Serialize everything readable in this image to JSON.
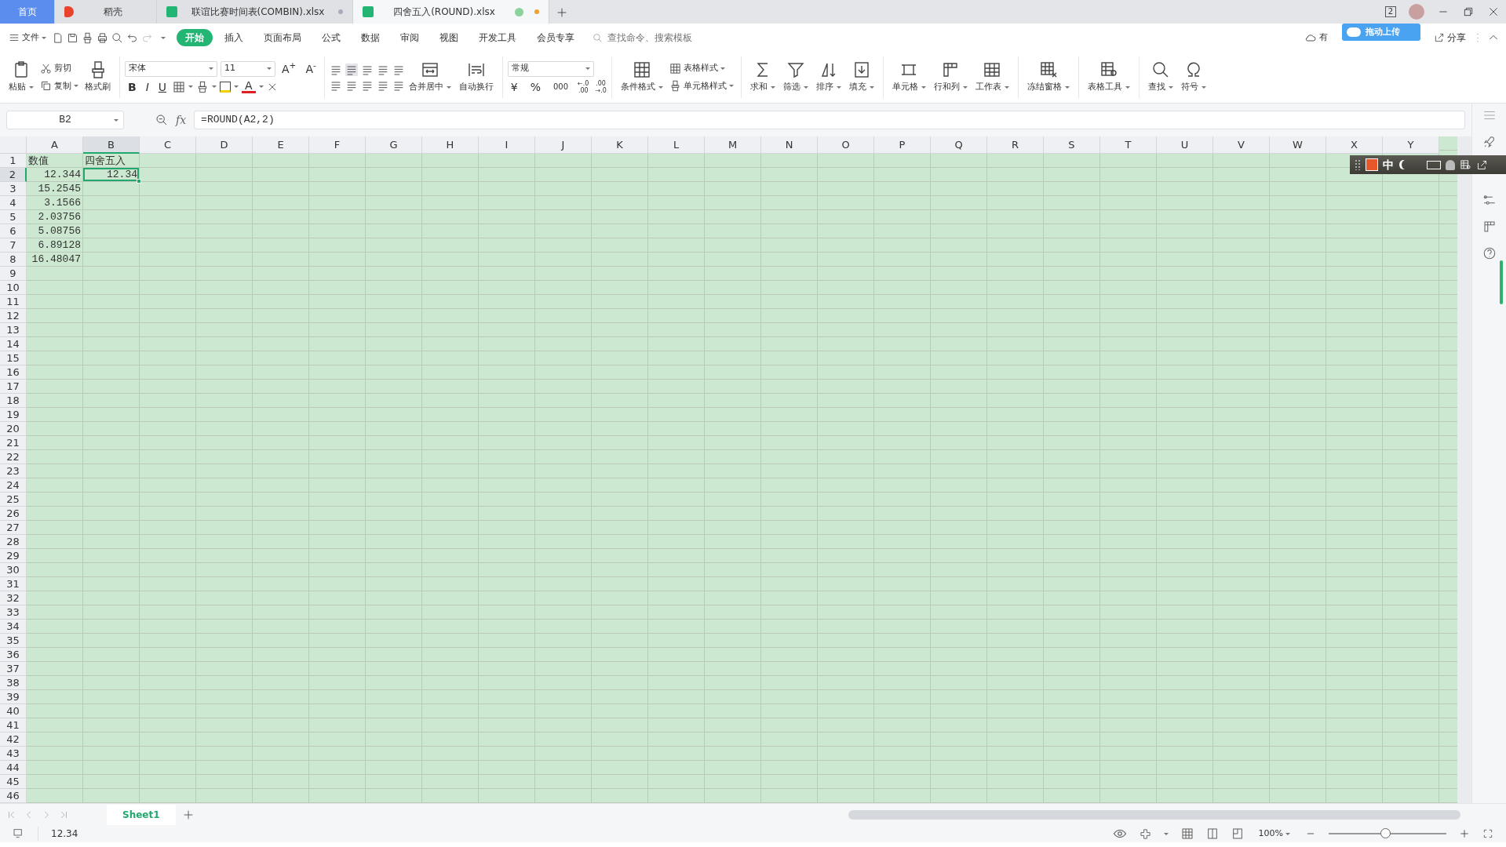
{
  "app_tabs": [
    {
      "label": "首页",
      "kind": "home",
      "selected": false
    },
    {
      "label": "稻壳",
      "kind": "docer",
      "selected": false
    },
    {
      "label": "联谊比赛时间表(COMBIN).xlsx",
      "kind": "sheet",
      "selected": false
    },
    {
      "label": "四舍五入(ROUND).xlsx",
      "kind": "sheet",
      "selected": true
    }
  ],
  "window_count": "2",
  "menu": {
    "file": "文件",
    "tabs": [
      {
        "label": "开始",
        "selected": true
      },
      {
        "label": "插入",
        "selected": false
      },
      {
        "label": "页面布局",
        "selected": false
      },
      {
        "label": "公式",
        "selected": false
      },
      {
        "label": "数据",
        "selected": false
      },
      {
        "label": "审阅",
        "selected": false
      },
      {
        "label": "视图",
        "selected": false
      },
      {
        "label": "开发工具",
        "selected": false
      },
      {
        "label": "会员专享",
        "selected": false
      }
    ],
    "search_placeholder": "查找命令、搜索模板",
    "cloud_label": "有",
    "share": "分享"
  },
  "upload_popup": "拖动上传",
  "ribbon": {
    "paste": "粘贴",
    "cut": "剪切",
    "copy": "复制",
    "painter": "格式刷",
    "font_name": "宋体",
    "font_size": "11",
    "grow": "A$^{+}$",
    "shrink": "A$^{-}$",
    "bold": "B",
    "italic": "I",
    "underline": "U",
    "font_color": "A",
    "merge": "合并居中",
    "wrap": "自动换行",
    "number_format": "常规",
    "currency": "¥",
    "percent": "%",
    "thousands": "000",
    "inc_decimal": [
      "←.0",
      ".00"
    ],
    "dec_decimal": [
      ".00",
      "→.0"
    ],
    "table_style": "表格样式",
    "cell_style": "单元格样式",
    "conditional": "条件格式",
    "tools": [
      {
        "label": "求和"
      },
      {
        "label": "筛选"
      },
      {
        "label": "排序"
      },
      {
        "label": "填充"
      },
      {
        "label": "单元格"
      },
      {
        "label": "行和列"
      },
      {
        "label": "工作表"
      },
      {
        "label": "冻结窗格"
      },
      {
        "label": "表格工具"
      },
      {
        "label": "查找"
      },
      {
        "label": "符号"
      }
    ]
  },
  "formula_bar": {
    "name_box": "B2",
    "fx": "fx",
    "formula": "=ROUND(A2,2)"
  },
  "columns": [
    {
      "label": "A",
      "selected": false
    },
    {
      "label": "B",
      "selected": true
    },
    {
      "label": "C",
      "selected": false
    },
    {
      "label": "D",
      "selected": false
    },
    {
      "label": "E",
      "selected": false
    },
    {
      "label": "F",
      "selected": false
    },
    {
      "label": "G",
      "selected": false
    },
    {
      "label": "H",
      "selected": false
    },
    {
      "label": "I",
      "selected": false
    },
    {
      "label": "J",
      "selected": false
    },
    {
      "label": "K",
      "selected": false
    },
    {
      "label": "L",
      "selected": false
    },
    {
      "label": "M",
      "selected": false
    },
    {
      "label": "N",
      "selected": false
    },
    {
      "label": "O",
      "selected": false
    },
    {
      "label": "P",
      "selected": false
    },
    {
      "label": "Q",
      "selected": false
    },
    {
      "label": "R",
      "selected": false
    },
    {
      "label": "S",
      "selected": false
    },
    {
      "label": "T",
      "selected": false
    },
    {
      "label": "U",
      "selected": false
    },
    {
      "label": "V",
      "selected": false
    },
    {
      "label": "W",
      "selected": false
    },
    {
      "label": "X",
      "selected": false
    },
    {
      "label": "Y",
      "selected": false
    }
  ],
  "rows": [
    {
      "label": "1",
      "selected": false
    },
    {
      "label": "2",
      "selected": true
    },
    {
      "label": "3",
      "selected": false
    },
    {
      "label": "4",
      "selected": false
    },
    {
      "label": "5",
      "selected": false
    },
    {
      "label": "6",
      "selected": false
    },
    {
      "label": "7",
      "selected": false
    },
    {
      "label": "8",
      "selected": false
    },
    {
      "label": "9",
      "selected": false
    },
    {
      "label": "10",
      "selected": false
    },
    {
      "label": "11",
      "selected": false
    },
    {
      "label": "12",
      "selected": false
    },
    {
      "label": "13",
      "selected": false
    },
    {
      "label": "14",
      "selected": false
    },
    {
      "label": "15",
      "selected": false
    },
    {
      "label": "16",
      "selected": false
    },
    {
      "label": "17",
      "selected": false
    },
    {
      "label": "18",
      "selected": false
    },
    {
      "label": "19",
      "selected": false
    },
    {
      "label": "20",
      "selected": false
    },
    {
      "label": "21",
      "selected": false
    },
    {
      "label": "22",
      "selected": false
    },
    {
      "label": "23",
      "selected": false
    },
    {
      "label": "24",
      "selected": false
    },
    {
      "label": "25",
      "selected": false
    },
    {
      "label": "26",
      "selected": false
    },
    {
      "label": "27",
      "selected": false
    },
    {
      "label": "28",
      "selected": false
    },
    {
      "label": "29",
      "selected": false
    },
    {
      "label": "30",
      "selected": false
    },
    {
      "label": "31",
      "selected": false
    },
    {
      "label": "32",
      "selected": false
    },
    {
      "label": "33",
      "selected": false
    },
    {
      "label": "34",
      "selected": false
    },
    {
      "label": "35",
      "selected": false
    },
    {
      "label": "36",
      "selected": false
    },
    {
      "label": "37",
      "selected": false
    },
    {
      "label": "38",
      "selected": false
    },
    {
      "label": "39",
      "selected": false
    },
    {
      "label": "40",
      "selected": false
    },
    {
      "label": "41",
      "selected": false
    },
    {
      "label": "42",
      "selected": false
    },
    {
      "label": "43",
      "selected": false
    },
    {
      "label": "44",
      "selected": false
    },
    {
      "label": "45",
      "selected": false
    },
    {
      "label": "46",
      "selected": false
    }
  ],
  "cells": [
    [
      {
        "value": "数值",
        "kind": "text"
      },
      {
        "value": "四舍五入",
        "kind": "text"
      }
    ],
    [
      {
        "value": "12.344",
        "kind": "number"
      },
      {
        "value": "12.34",
        "kind": "number"
      }
    ],
    [
      {
        "value": "15.2545",
        "kind": "number"
      }
    ],
    [
      {
        "value": "3.1566",
        "kind": "number"
      }
    ],
    [
      {
        "value": "2.03756",
        "kind": "number"
      }
    ],
    [
      {
        "value": "5.08756",
        "kind": "number"
      }
    ],
    [
      {
        "value": "6.89128",
        "kind": "number"
      }
    ],
    [
      {
        "value": "16.48047",
        "kind": "number"
      }
    ]
  ],
  "sheet_tabs": [
    {
      "label": "Sheet1",
      "selected": true
    }
  ],
  "ime_bar": {
    "mode": "中"
  },
  "status_bar": {
    "value": "12.34",
    "zoom": "100%",
    "zoom_slider": {
      "level": 0.48
    }
  }
}
